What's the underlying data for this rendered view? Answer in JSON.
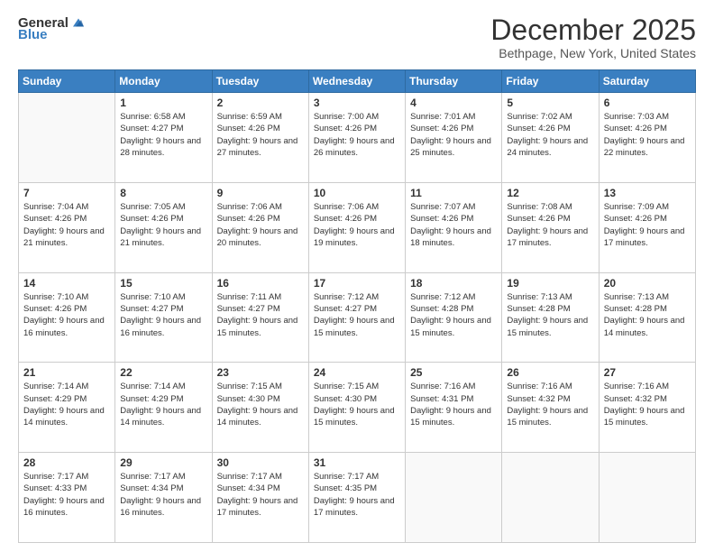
{
  "header": {
    "logo_general": "General",
    "logo_blue": "Blue",
    "title": "December 2025",
    "location": "Bethpage, New York, United States"
  },
  "days_of_week": [
    "Sunday",
    "Monday",
    "Tuesday",
    "Wednesday",
    "Thursday",
    "Friday",
    "Saturday"
  ],
  "weeks": [
    [
      {
        "day": "",
        "sunrise": "",
        "sunset": "",
        "daylight": ""
      },
      {
        "day": "1",
        "sunrise": "Sunrise: 6:58 AM",
        "sunset": "Sunset: 4:27 PM",
        "daylight": "Daylight: 9 hours and 28 minutes."
      },
      {
        "day": "2",
        "sunrise": "Sunrise: 6:59 AM",
        "sunset": "Sunset: 4:26 PM",
        "daylight": "Daylight: 9 hours and 27 minutes."
      },
      {
        "day": "3",
        "sunrise": "Sunrise: 7:00 AM",
        "sunset": "Sunset: 4:26 PM",
        "daylight": "Daylight: 9 hours and 26 minutes."
      },
      {
        "day": "4",
        "sunrise": "Sunrise: 7:01 AM",
        "sunset": "Sunset: 4:26 PM",
        "daylight": "Daylight: 9 hours and 25 minutes."
      },
      {
        "day": "5",
        "sunrise": "Sunrise: 7:02 AM",
        "sunset": "Sunset: 4:26 PM",
        "daylight": "Daylight: 9 hours and 24 minutes."
      },
      {
        "day": "6",
        "sunrise": "Sunrise: 7:03 AM",
        "sunset": "Sunset: 4:26 PM",
        "daylight": "Daylight: 9 hours and 22 minutes."
      }
    ],
    [
      {
        "day": "7",
        "sunrise": "Sunrise: 7:04 AM",
        "sunset": "Sunset: 4:26 PM",
        "daylight": "Daylight: 9 hours and 21 minutes."
      },
      {
        "day": "8",
        "sunrise": "Sunrise: 7:05 AM",
        "sunset": "Sunset: 4:26 PM",
        "daylight": "Daylight: 9 hours and 21 minutes."
      },
      {
        "day": "9",
        "sunrise": "Sunrise: 7:06 AM",
        "sunset": "Sunset: 4:26 PM",
        "daylight": "Daylight: 9 hours and 20 minutes."
      },
      {
        "day": "10",
        "sunrise": "Sunrise: 7:06 AM",
        "sunset": "Sunset: 4:26 PM",
        "daylight": "Daylight: 9 hours and 19 minutes."
      },
      {
        "day": "11",
        "sunrise": "Sunrise: 7:07 AM",
        "sunset": "Sunset: 4:26 PM",
        "daylight": "Daylight: 9 hours and 18 minutes."
      },
      {
        "day": "12",
        "sunrise": "Sunrise: 7:08 AM",
        "sunset": "Sunset: 4:26 PM",
        "daylight": "Daylight: 9 hours and 17 minutes."
      },
      {
        "day": "13",
        "sunrise": "Sunrise: 7:09 AM",
        "sunset": "Sunset: 4:26 PM",
        "daylight": "Daylight: 9 hours and 17 minutes."
      }
    ],
    [
      {
        "day": "14",
        "sunrise": "Sunrise: 7:10 AM",
        "sunset": "Sunset: 4:26 PM",
        "daylight": "Daylight: 9 hours and 16 minutes."
      },
      {
        "day": "15",
        "sunrise": "Sunrise: 7:10 AM",
        "sunset": "Sunset: 4:27 PM",
        "daylight": "Daylight: 9 hours and 16 minutes."
      },
      {
        "day": "16",
        "sunrise": "Sunrise: 7:11 AM",
        "sunset": "Sunset: 4:27 PM",
        "daylight": "Daylight: 9 hours and 15 minutes."
      },
      {
        "day": "17",
        "sunrise": "Sunrise: 7:12 AM",
        "sunset": "Sunset: 4:27 PM",
        "daylight": "Daylight: 9 hours and 15 minutes."
      },
      {
        "day": "18",
        "sunrise": "Sunrise: 7:12 AM",
        "sunset": "Sunset: 4:28 PM",
        "daylight": "Daylight: 9 hours and 15 minutes."
      },
      {
        "day": "19",
        "sunrise": "Sunrise: 7:13 AM",
        "sunset": "Sunset: 4:28 PM",
        "daylight": "Daylight: 9 hours and 15 minutes."
      },
      {
        "day": "20",
        "sunrise": "Sunrise: 7:13 AM",
        "sunset": "Sunset: 4:28 PM",
        "daylight": "Daylight: 9 hours and 14 minutes."
      }
    ],
    [
      {
        "day": "21",
        "sunrise": "Sunrise: 7:14 AM",
        "sunset": "Sunset: 4:29 PM",
        "daylight": "Daylight: 9 hours and 14 minutes."
      },
      {
        "day": "22",
        "sunrise": "Sunrise: 7:14 AM",
        "sunset": "Sunset: 4:29 PM",
        "daylight": "Daylight: 9 hours and 14 minutes."
      },
      {
        "day": "23",
        "sunrise": "Sunrise: 7:15 AM",
        "sunset": "Sunset: 4:30 PM",
        "daylight": "Daylight: 9 hours and 14 minutes."
      },
      {
        "day": "24",
        "sunrise": "Sunrise: 7:15 AM",
        "sunset": "Sunset: 4:30 PM",
        "daylight": "Daylight: 9 hours and 15 minutes."
      },
      {
        "day": "25",
        "sunrise": "Sunrise: 7:16 AM",
        "sunset": "Sunset: 4:31 PM",
        "daylight": "Daylight: 9 hours and 15 minutes."
      },
      {
        "day": "26",
        "sunrise": "Sunrise: 7:16 AM",
        "sunset": "Sunset: 4:32 PM",
        "daylight": "Daylight: 9 hours and 15 minutes."
      },
      {
        "day": "27",
        "sunrise": "Sunrise: 7:16 AM",
        "sunset": "Sunset: 4:32 PM",
        "daylight": "Daylight: 9 hours and 15 minutes."
      }
    ],
    [
      {
        "day": "28",
        "sunrise": "Sunrise: 7:17 AM",
        "sunset": "Sunset: 4:33 PM",
        "daylight": "Daylight: 9 hours and 16 minutes."
      },
      {
        "day": "29",
        "sunrise": "Sunrise: 7:17 AM",
        "sunset": "Sunset: 4:34 PM",
        "daylight": "Daylight: 9 hours and 16 minutes."
      },
      {
        "day": "30",
        "sunrise": "Sunrise: 7:17 AM",
        "sunset": "Sunset: 4:34 PM",
        "daylight": "Daylight: 9 hours and 17 minutes."
      },
      {
        "day": "31",
        "sunrise": "Sunrise: 7:17 AM",
        "sunset": "Sunset: 4:35 PM",
        "daylight": "Daylight: 9 hours and 17 minutes."
      },
      {
        "day": "",
        "sunrise": "",
        "sunset": "",
        "daylight": ""
      },
      {
        "day": "",
        "sunrise": "",
        "sunset": "",
        "daylight": ""
      },
      {
        "day": "",
        "sunrise": "",
        "sunset": "",
        "daylight": ""
      }
    ]
  ]
}
